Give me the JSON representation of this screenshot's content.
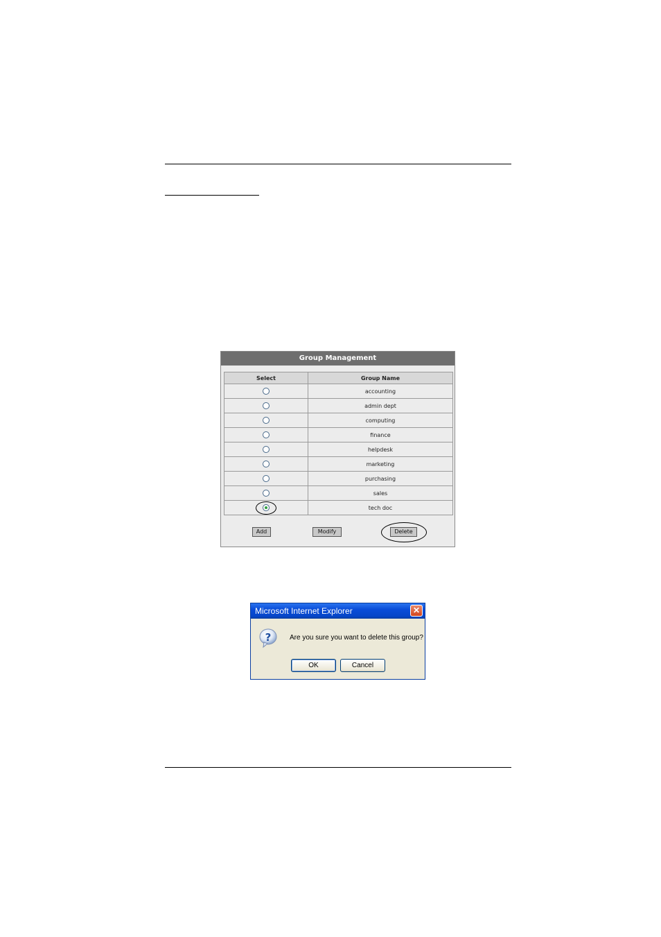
{
  "group_management": {
    "title": "Group Management",
    "columns": [
      "Select",
      "Group Name"
    ],
    "rows": [
      {
        "name": "accounting",
        "selected": false
      },
      {
        "name": "admin dept",
        "selected": false
      },
      {
        "name": "computing",
        "selected": false
      },
      {
        "name": "finance",
        "selected": false
      },
      {
        "name": "helpdesk",
        "selected": false
      },
      {
        "name": "marketing",
        "selected": false
      },
      {
        "name": "purchasing",
        "selected": false
      },
      {
        "name": "sales",
        "selected": false
      },
      {
        "name": "tech doc",
        "selected": true
      }
    ],
    "buttons": {
      "add": "Add",
      "modify": "Modify",
      "delete": "Delete"
    }
  },
  "dialog": {
    "title": "Microsoft Internet Explorer",
    "close_symbol": "✕",
    "icon": "question-icon",
    "message": "Are you sure you want to delete this group?",
    "ok": "OK",
    "cancel": "Cancel"
  },
  "colors": {
    "panel_title_bg": "#6e6e6e",
    "panel_bg": "#ececec",
    "xp_titlebar": "#0a4dd8",
    "dialog_bg": "#ece9d8"
  }
}
